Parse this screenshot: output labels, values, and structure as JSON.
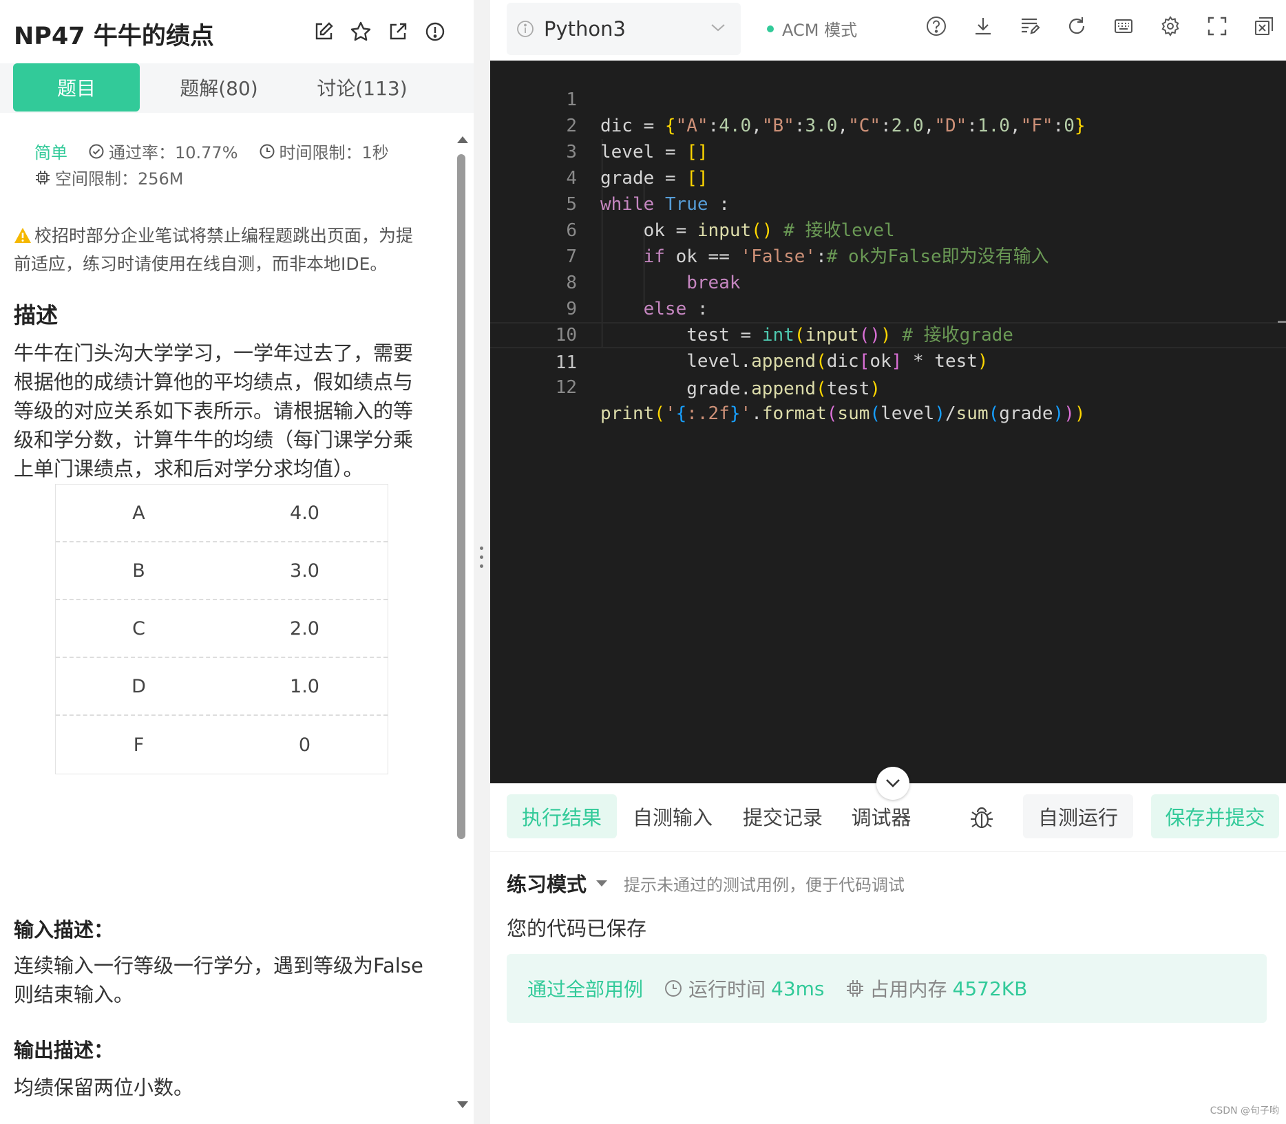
{
  "problem": {
    "title": "NP47  牛牛的绩点",
    "tabs": [
      "题目",
      "题解(80)",
      "讨论(113)"
    ],
    "difficulty": "简单",
    "pass_rate": "通过率：10.77%",
    "time_limit": "时间限制：1秒",
    "space_limit": "空间限制：256M",
    "warning": "校招时部分企业笔试将禁止编程题跳出页面，为提前适应，练习时请使用在线自测，而非本地IDE。",
    "desc_heading": "描述",
    "desc": "牛牛在门头沟大学学习，一学年过去了，需要根据他的成绩计算他的平均绩点，假如绩点与等级的对应关系如下表所示。请根据输入的等级和学分数，计算牛牛的均绩（每门课学分乘上单门课绩点，求和后对学分求均值）。",
    "grade_table": [
      [
        "A",
        "4.0"
      ],
      [
        "B",
        "3.0"
      ],
      [
        "C",
        "2.0"
      ],
      [
        "D",
        "1.0"
      ],
      [
        "F",
        "0"
      ]
    ],
    "input_heading": "输入描述：",
    "input_desc": "连续输入一行等级一行学分，遇到等级为False则结束输入。",
    "output_heading": "输出描述：",
    "output_desc": "均绩保留两位小数。"
  },
  "editor": {
    "language": "Python3",
    "mode": "ACM 模式",
    "current_line": 11,
    "line_numbers": [
      "1",
      "2",
      "3",
      "4",
      "5",
      "6",
      "7",
      "8",
      "9",
      "10",
      "11",
      "12"
    ]
  },
  "bottom": {
    "tabs": [
      "执行结果",
      "自测输入",
      "提交记录",
      "调试器"
    ],
    "run_label": "自测运行",
    "submit_label": "保存并提交",
    "mode_label": "练习模式",
    "mode_hint": "提示未通过的测试用例，便于代码调试",
    "saved_msg": "您的代码已保存",
    "result": {
      "status": "通过全部用例",
      "time_label": "运行时间",
      "time_value": "43ms",
      "mem_label": "占用内存",
      "mem_value": "4572KB"
    }
  },
  "watermark": "CSDN @句子哟",
  "colors": {
    "accent": "#32ca99",
    "editor_bg": "#1e1e1e"
  }
}
